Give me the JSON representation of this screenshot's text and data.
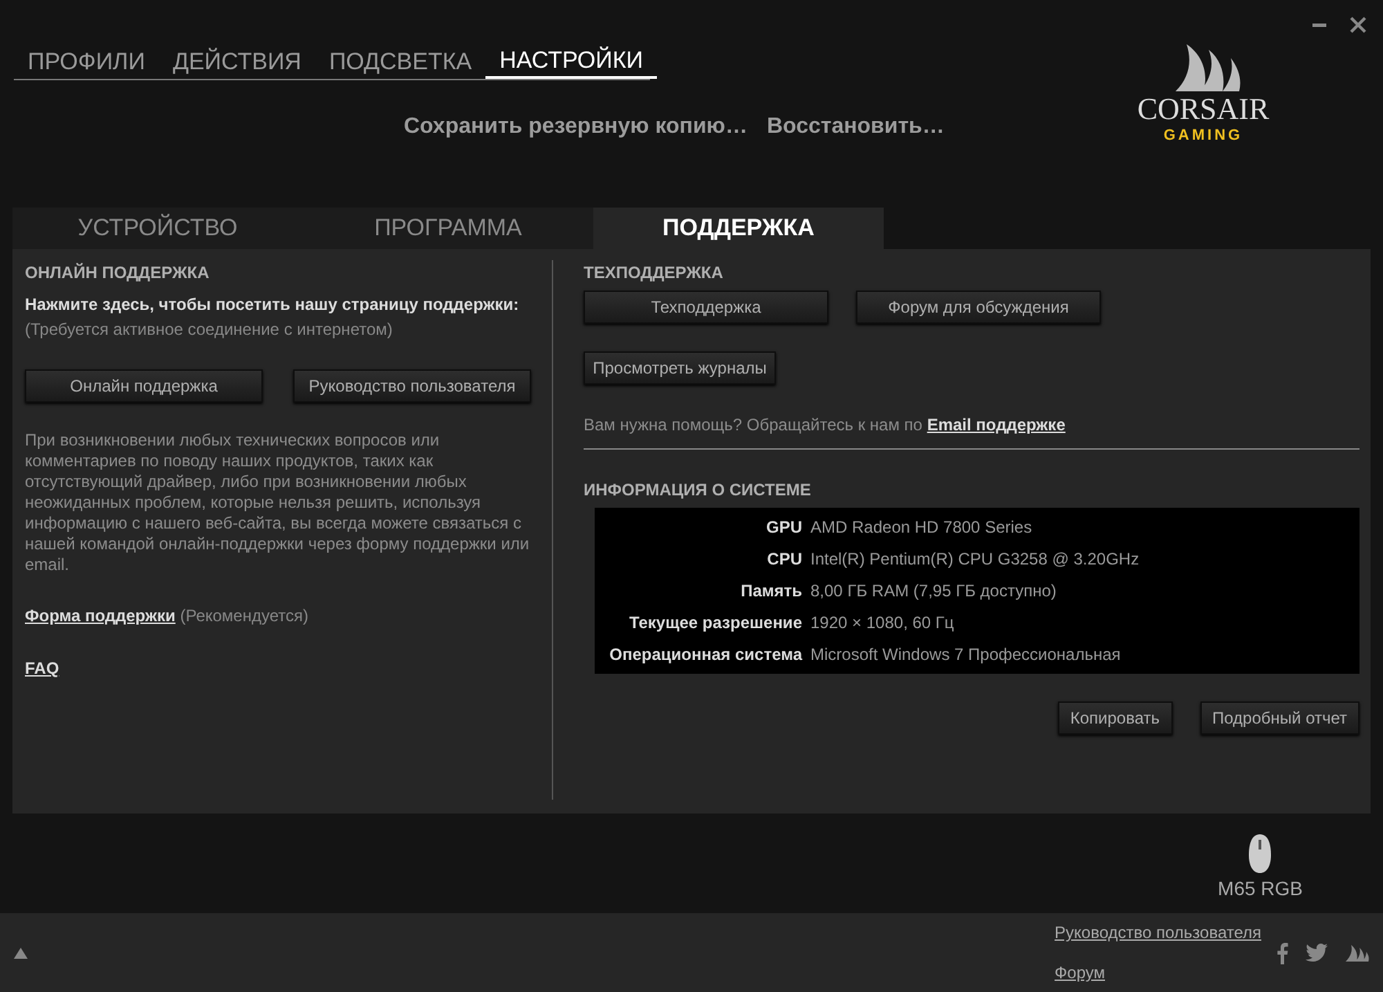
{
  "nav_tabs": [
    {
      "label": "ПРОФИЛИ",
      "selected": false
    },
    {
      "label": "ДЕЙСТВИЯ",
      "selected": false
    },
    {
      "label": "ПОДСВЕТКА",
      "selected": false
    },
    {
      "label": "НАСТРОЙКИ",
      "selected": true
    }
  ],
  "backup_links": [
    "Сохранить резервную копию…",
    "Восстановить…"
  ],
  "logo": {
    "name": "CORSAIR",
    "sub": "GAMING"
  },
  "settings_tabs": [
    {
      "label": "УСТРОЙСТВО",
      "selected": false
    },
    {
      "label": "ПРОГРАММА",
      "selected": false
    },
    {
      "label": "ПОДДЕРЖКА",
      "selected": true
    }
  ],
  "online_support": {
    "heading": "ОНЛАЙН ПОДДЕРЖКА",
    "prompt": "Нажмите здесь, чтобы посетить нашу страницу поддержки:",
    "note": "(Требуется активное соединение с интернетом)",
    "buttons": [
      "Онлайн поддержка",
      "Руководство пользователя"
    ],
    "description": "При возникновении любых технических вопросов или комментариев по поводу наших продуктов, таких как отсутствующий драйвер, либо при возникновении любых неожиданных проблем, которые нельзя решить, используя информацию с нашего веб-сайта, вы всегда можете связаться с нашей командой онлайн-поддержки через форму поддержки или email.",
    "form_link": "Форма поддержки",
    "form_note": "(Рекомендуется)",
    "faq_link": "FAQ"
  },
  "tech_support": {
    "heading": "ТЕХПОДДЕРЖКА",
    "buttons": [
      "Техподдержка",
      "Форум для обсуждения"
    ],
    "logs_button": "Просмотреть журналы",
    "help_text": "Вам нужна помощь? Обращайтесь к нам по",
    "email_link": "Email поддержке"
  },
  "system_info": {
    "heading": "ИНФОРМАЦИЯ О СИСТЕМЕ",
    "rows": [
      {
        "label": "GPU",
        "value": "AMD Radeon HD 7800 Series"
      },
      {
        "label": "CPU",
        "value": "Intel(R) Pentium(R) CPU G3258 @ 3.20GHz"
      },
      {
        "label": "Память",
        "value": "8,00 ГБ RAM (7,95 ГБ доступно)"
      },
      {
        "label": "Текущее разрешение",
        "value": "1920 × 1080, 60 Гц"
      },
      {
        "label": "Операционная система",
        "value": "Microsoft Windows 7 Профессиональная"
      }
    ],
    "buttons": [
      "Копировать",
      "Подробный отчет"
    ]
  },
  "device": {
    "name": "M65 RGB"
  },
  "footer_links": [
    "Руководство пользователя",
    "Форум"
  ]
}
